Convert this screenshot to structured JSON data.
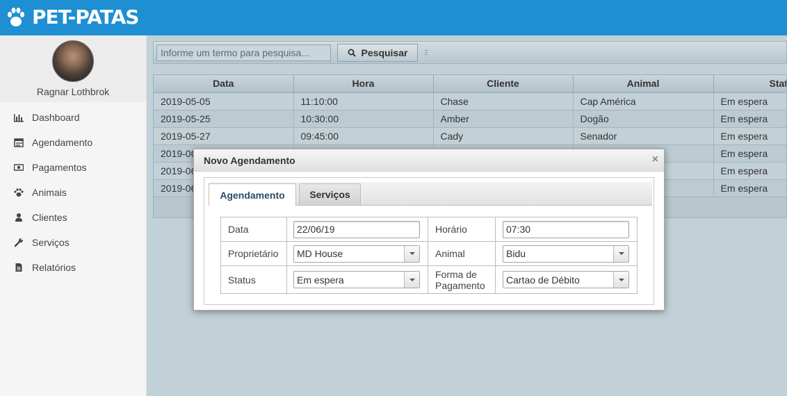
{
  "brand": {
    "name": "PET-PATAS",
    "icon": "paw-icon"
  },
  "user": {
    "name": "Ragnar Lothbrok"
  },
  "menu": [
    {
      "label": "Dashboard",
      "icon": "bar-chart-icon"
    },
    {
      "label": "Agendamento",
      "icon": "calendar-icon"
    },
    {
      "label": "Pagamentos",
      "icon": "money-icon"
    },
    {
      "label": "Animais",
      "icon": "paw-icon"
    },
    {
      "label": "Clientes",
      "icon": "user-icon"
    },
    {
      "label": "Serviços",
      "icon": "wrench-icon"
    },
    {
      "label": "Relatórios",
      "icon": "file-icon"
    }
  ],
  "search": {
    "placeholder": "Informe um termo para pesquisa...",
    "button": "Pesquisar"
  },
  "table": {
    "headers": [
      "Data",
      "Hora",
      "Cliente",
      "Animal",
      "Status"
    ],
    "rows": [
      [
        "2019-05-05",
        "11:10:00",
        "Chase",
        "Cap América",
        "Em espera"
      ],
      [
        "2019-05-25",
        "10:30:00",
        "Amber",
        "Dogão",
        "Em espera"
      ],
      [
        "2019-05-27",
        "09:45:00",
        "Cady",
        "Senador",
        "Em espera"
      ],
      [
        "2019-06",
        "",
        "",
        "",
        "Em espera"
      ],
      [
        "2019-06",
        "",
        "",
        "",
        "Em espera"
      ],
      [
        "2019-06",
        "",
        "",
        "",
        "Em espera"
      ]
    ]
  },
  "modal": {
    "title": "Novo Agendamento",
    "close": "×",
    "tabs": [
      "Agendamento",
      "Serviços"
    ],
    "form": {
      "data_label": "Data",
      "data_value": "22/06/19",
      "horario_label": "Horário",
      "horario_value": "07:30",
      "proprietario_label": "Proprietário",
      "proprietario_value": "MD House",
      "animal_label": "Animal",
      "animal_value": "Bidu",
      "status_label": "Status",
      "status_value": "Em espera",
      "pagamento_label_line1": "Forma de",
      "pagamento_label_line2": "Pagamento",
      "pagamento_value": "Cartao de Débito"
    }
  },
  "colors": {
    "header": "#1e8fd3",
    "sidebar": "#f5f5f5",
    "grid": "#c3d1d7"
  }
}
